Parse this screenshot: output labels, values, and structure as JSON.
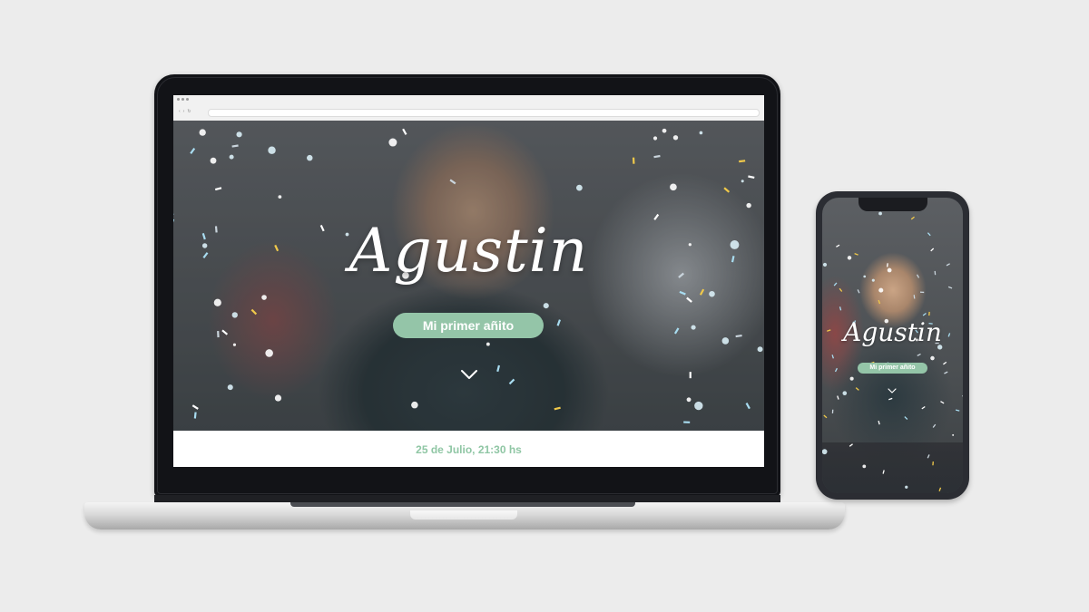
{
  "desktop": {
    "hero_name": "Agustin",
    "badge": "Mi primer añito",
    "event_date": "25 de Julio, 21:30 hs"
  },
  "mobile": {
    "hero_name": "Agustin",
    "badge": "Mi primer añito"
  },
  "icons": {
    "scroll_down": "chevron-down-icon",
    "browser_nav": [
      "back-icon",
      "forward-icon",
      "reload-icon"
    ]
  },
  "colors": {
    "accent_green": "#94c5a8",
    "date_green": "#8fc6a4",
    "confetti": [
      "#f0c94a",
      "#a8dcf0",
      "#ffffff",
      "#c9d4dc"
    ]
  }
}
